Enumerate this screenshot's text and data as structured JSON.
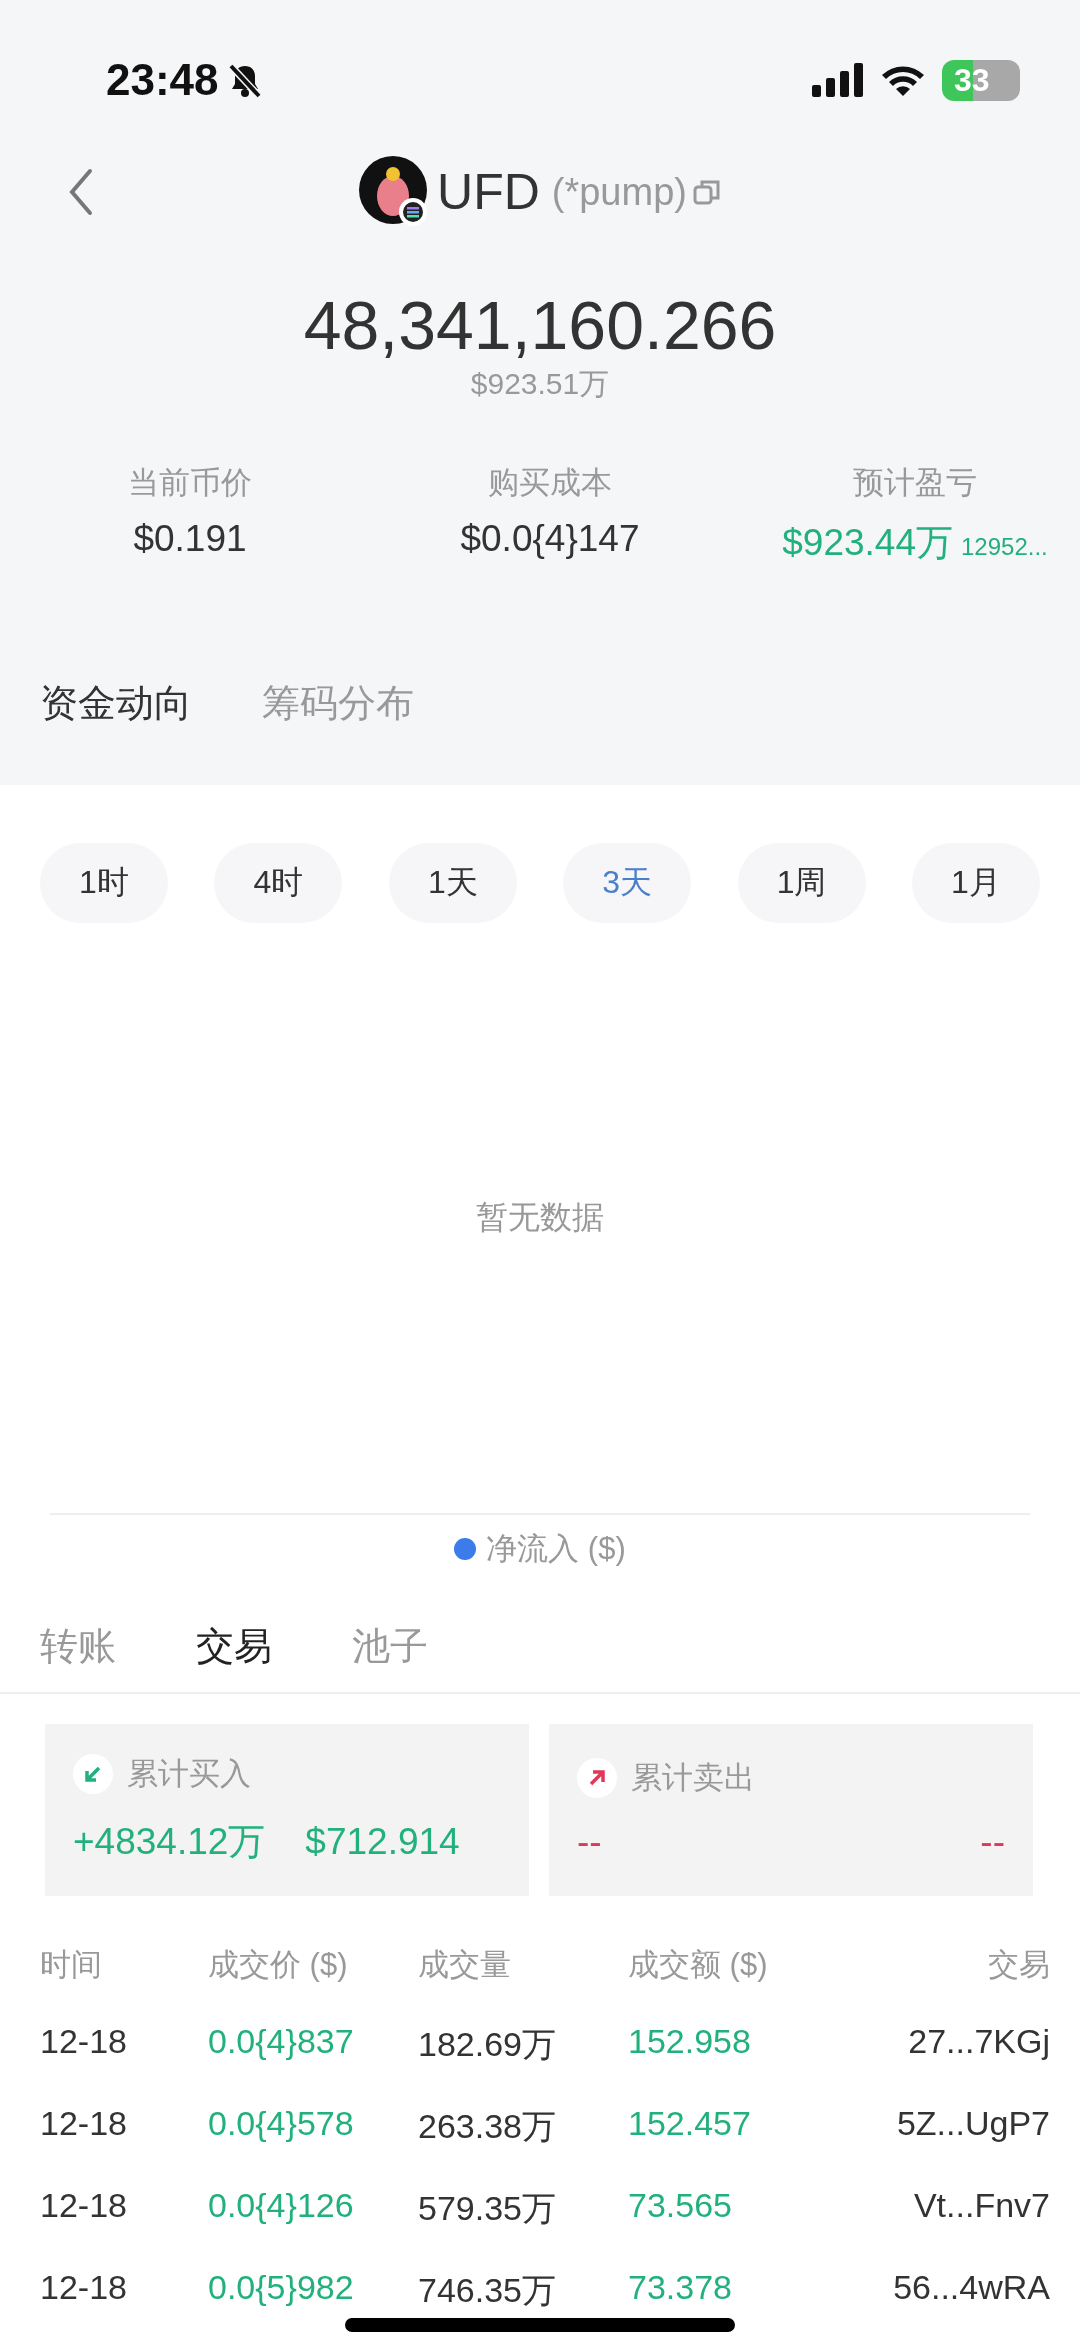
{
  "status_bar": {
    "time": "23:48",
    "muted": true,
    "battery": "33",
    "charging": true
  },
  "header": {
    "symbol": "UFD",
    "platform": "(*pump)"
  },
  "balance": {
    "amount": "48,341,160.266",
    "value": "$923.51万"
  },
  "stats": [
    {
      "label": "当前币价",
      "value": "$0.191",
      "gain": false
    },
    {
      "label": "购买成本",
      "value": "$0.0{4}147",
      "gain": false
    },
    {
      "label": "预计盈亏",
      "value": "$923.44万",
      "extra": "12952...",
      "gain": true
    }
  ],
  "section_tabs": [
    {
      "label": "资金动向",
      "selected": true
    },
    {
      "label": "筹码分布",
      "selected": false
    }
  ],
  "periods": [
    {
      "label": "1时",
      "selected": false
    },
    {
      "label": "4时",
      "selected": false
    },
    {
      "label": "1天",
      "selected": false
    },
    {
      "label": "3天",
      "selected": true
    },
    {
      "label": "1周",
      "selected": false
    },
    {
      "label": "1月",
      "selected": false
    }
  ],
  "chart": {
    "empty_text": "暂无数据",
    "legend": {
      "label": "净流入 ($)",
      "color": "#3b7bea"
    }
  },
  "tx_tabs": [
    {
      "label": "转账",
      "selected": false
    },
    {
      "label": "交易",
      "selected": true
    },
    {
      "label": "池子",
      "selected": false
    }
  ],
  "summary": [
    {
      "kind": "buy",
      "label": "累计买入",
      "amount": "+4834.12万",
      "value": "$712.914"
    },
    {
      "kind": "sell",
      "label": "累计卖出",
      "amount": "--",
      "value": "--"
    }
  ],
  "table": {
    "columns": [
      "时间",
      "成交价 ($)",
      "成交量",
      "成交额 ($)",
      "交易"
    ],
    "rows": [
      [
        "12-18",
        "0.0{4}837",
        "182.69万",
        "152.958",
        "27...7KGj"
      ],
      [
        "12-18",
        "0.0{4}578",
        "263.38万",
        "152.457",
        "5Z...UgP7"
      ],
      [
        "12-18",
        "0.0{4}126",
        "579.35万",
        "73.565",
        "Vt...Fnv7"
      ],
      [
        "12-18",
        "0.0{5}982",
        "746.35万",
        "73.378",
        "56...4wRA"
      ]
    ]
  }
}
